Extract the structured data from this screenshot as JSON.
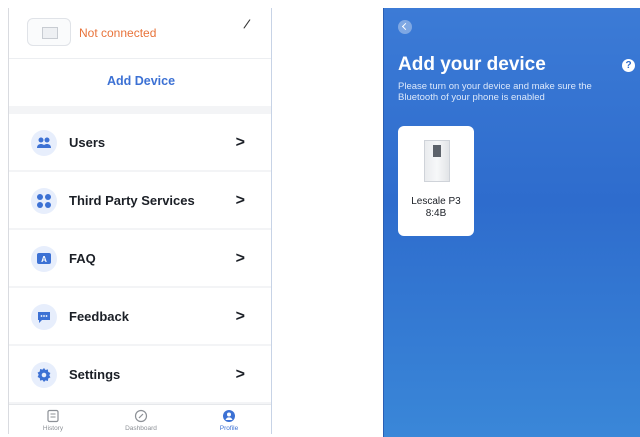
{
  "left": {
    "device_status": "Not connected",
    "add_device_label": "Add Device",
    "menu": [
      {
        "label": "Users",
        "icon": "users-icon"
      },
      {
        "label": "Third Party Services",
        "icon": "apps-icon"
      },
      {
        "label": "FAQ",
        "icon": "faq-icon"
      },
      {
        "label": "Feedback",
        "icon": "feedback-icon"
      },
      {
        "label": "Settings",
        "icon": "gear-icon"
      }
    ],
    "tabs": [
      {
        "label": "History",
        "icon": "history-icon"
      },
      {
        "label": "Dashboard",
        "icon": "compass-icon"
      },
      {
        "label": "Profile",
        "icon": "profile-icon"
      }
    ],
    "active_tab": "Profile"
  },
  "right": {
    "title": "Add your device",
    "subtitle": "Please turn on your device and make sure the Bluetooth of your phone is enabled",
    "device": {
      "name": "Lescale P3",
      "id": "8:4B"
    }
  },
  "colors": {
    "accent_blue": "#3c71d4",
    "status_orange": "#e8733a",
    "panel_blue": "#2e6ccd"
  }
}
